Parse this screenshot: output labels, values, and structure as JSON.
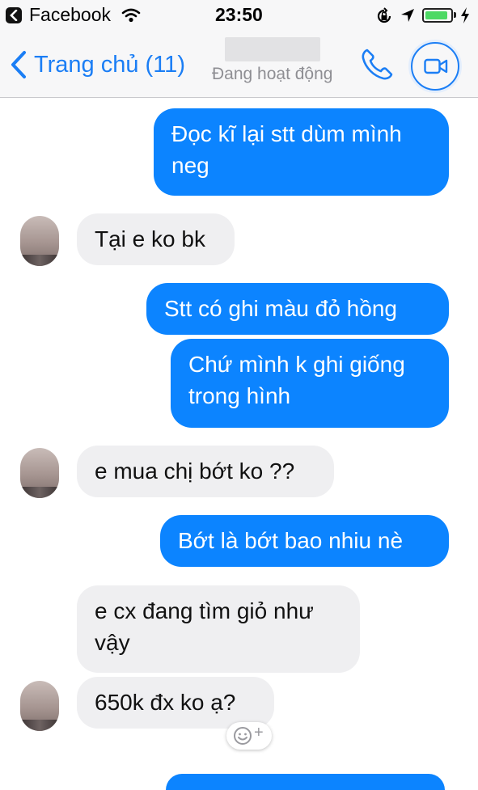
{
  "status_bar": {
    "back_app": "Facebook",
    "time": "23:50",
    "battery_level": 0.9
  },
  "nav": {
    "back_label": "Trang chủ (11)",
    "status": "Đang hoạt động"
  },
  "messages": [
    {
      "direction": "out",
      "text": "Đọc kĩ lại stt dùm mình neg"
    },
    {
      "direction": "in",
      "text": "Tại e ko bk"
    },
    {
      "direction": "out",
      "text": "Stt có ghi màu đỏ hồng"
    },
    {
      "direction": "out",
      "text": "Chứ mình k ghi giống trong hình"
    },
    {
      "direction": "in",
      "text": "e mua chị bớt ko ??"
    },
    {
      "direction": "out",
      "text": "Bớt là bớt bao nhiu nè"
    },
    {
      "direction": "in",
      "text": "e cx đang tìm giỏ như vậy"
    },
    {
      "direction": "in",
      "text": "650k đx ko ạ?"
    }
  ],
  "colors": {
    "accent": "#1b7ef5",
    "outgoing_bubble": "#0c84ff",
    "incoming_bubble": "#efeff1",
    "battery": "#4cd964"
  },
  "icons": {
    "back": "chevron-left-icon",
    "call": "phone-icon",
    "video": "video-camera-icon",
    "react": "smiley-add-icon"
  }
}
